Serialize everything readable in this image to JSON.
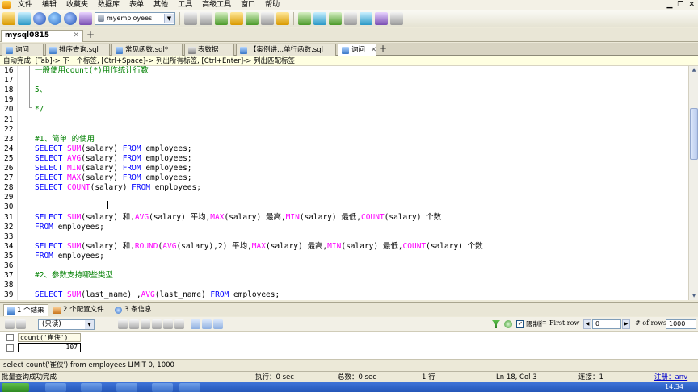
{
  "menu": [
    "文件",
    "编辑",
    "收藏夹",
    "数据库",
    "表单",
    "其他",
    "工具",
    "高级工具",
    "窗口",
    "帮助"
  ],
  "toolbar": {
    "db_select": "myemployees"
  },
  "connection_tab": {
    "label": "mysql0815"
  },
  "query_tabs": [
    {
      "label": "询问",
      "icon": "query-icon"
    },
    {
      "label": "排序查询.sql",
      "icon": "query-icon"
    },
    {
      "label": "常见函数.sql*",
      "icon": "query-icon"
    },
    {
      "label": "表数据",
      "icon": "table-icon"
    },
    {
      "label": "【案例讲...单行函数.sql",
      "icon": "query-icon"
    },
    {
      "label": "询问",
      "icon": "query-icon"
    }
  ],
  "hint": "自动完成: [Tab]-> 下一个标签, [Ctrl+Space]-> 列出所有标签, [Ctrl+Enter]-> 列出匹配标签",
  "editor_lines": [
    {
      "n": "16",
      "segs": [
        [
          "cm",
          "一般使用count(*)用作统计行数"
        ]
      ]
    },
    {
      "n": "17",
      "segs": []
    },
    {
      "n": "18",
      "segs": [
        [
          "cm",
          "5、"
        ]
      ]
    },
    {
      "n": "19",
      "segs": []
    },
    {
      "n": "20",
      "segs": [
        [
          "cm",
          "*/"
        ]
      ]
    },
    {
      "n": "21",
      "segs": []
    },
    {
      "n": "22",
      "segs": []
    },
    {
      "n": "23",
      "segs": [
        [
          "cm",
          "#1、简单 的使用"
        ]
      ]
    },
    {
      "n": "24",
      "segs": [
        [
          "kw",
          "SELECT "
        ],
        [
          "fn",
          "SUM"
        ],
        [
          "tx",
          "(salary) "
        ],
        [
          "kw",
          "FROM"
        ],
        [
          "tx",
          " employees;"
        ]
      ]
    },
    {
      "n": "25",
      "segs": [
        [
          "kw",
          "SELECT "
        ],
        [
          "fn",
          "AVG"
        ],
        [
          "tx",
          "(salary) "
        ],
        [
          "kw",
          "FROM"
        ],
        [
          "tx",
          " employees;"
        ]
      ]
    },
    {
      "n": "26",
      "segs": [
        [
          "kw",
          "SELECT "
        ],
        [
          "fn",
          "MIN"
        ],
        [
          "tx",
          "(salary) "
        ],
        [
          "kw",
          "FROM"
        ],
        [
          "tx",
          " employees;"
        ]
      ]
    },
    {
      "n": "27",
      "segs": [
        [
          "kw",
          "SELECT "
        ],
        [
          "fn",
          "MAX"
        ],
        [
          "tx",
          "(salary) "
        ],
        [
          "kw",
          "FROM"
        ],
        [
          "tx",
          " employees;"
        ]
      ]
    },
    {
      "n": "28",
      "segs": [
        [
          "kw",
          "SELECT "
        ],
        [
          "fn",
          "COUNT"
        ],
        [
          "tx",
          "(salary) "
        ],
        [
          "kw",
          "FROM"
        ],
        [
          "tx",
          " employees;"
        ]
      ]
    },
    {
      "n": "29",
      "segs": []
    },
    {
      "n": "30",
      "segs": []
    },
    {
      "n": "31",
      "segs": [
        [
          "kw",
          "SELECT "
        ],
        [
          "fn",
          "SUM"
        ],
        [
          "tx",
          "(salary) 和,"
        ],
        [
          "fn",
          "AVG"
        ],
        [
          "tx",
          "(salary) 平均,"
        ],
        [
          "fn",
          "MAX"
        ],
        [
          "tx",
          "(salary) 最高,"
        ],
        [
          "fn",
          "MIN"
        ],
        [
          "tx",
          "(salary) 最低,"
        ],
        [
          "fn",
          "COUNT"
        ],
        [
          "tx",
          "(salary) 个数"
        ]
      ]
    },
    {
      "n": "32",
      "segs": [
        [
          "kw",
          "FROM"
        ],
        [
          "tx",
          " employees;"
        ]
      ]
    },
    {
      "n": "33",
      "segs": []
    },
    {
      "n": "34",
      "segs": [
        [
          "kw",
          "SELECT "
        ],
        [
          "fn",
          "SUM"
        ],
        [
          "tx",
          "(salary) 和,"
        ],
        [
          "fn",
          "ROUND"
        ],
        [
          "tx",
          "("
        ],
        [
          "fn",
          "AVG"
        ],
        [
          "tx",
          "(salary),2) 平均,"
        ],
        [
          "fn",
          "MAX"
        ],
        [
          "tx",
          "(salary) 最高,"
        ],
        [
          "fn",
          "MIN"
        ],
        [
          "tx",
          "(salary) 最低,"
        ],
        [
          "fn",
          "COUNT"
        ],
        [
          "tx",
          "(salary) 个数"
        ]
      ]
    },
    {
      "n": "35",
      "segs": [
        [
          "kw",
          "FROM"
        ],
        [
          "tx",
          " employees;"
        ]
      ]
    },
    {
      "n": "36",
      "segs": []
    },
    {
      "n": "37",
      "segs": [
        [
          "cm",
          "#2、参数支持哪些类型"
        ]
      ]
    },
    {
      "n": "38",
      "segs": []
    },
    {
      "n": "39",
      "segs": [
        [
          "kw",
          "SELECT "
        ],
        [
          "fn",
          "SUM"
        ],
        [
          "tx",
          "(last_name) ,"
        ],
        [
          "fn",
          "AVG"
        ],
        [
          "tx",
          "(last_name) "
        ],
        [
          "kw",
          "FROM"
        ],
        [
          "tx",
          " employees;"
        ]
      ]
    }
  ],
  "result_tabs": [
    {
      "label": "1 个结果"
    },
    {
      "label": "2 个配置文件"
    },
    {
      "label": "3 条信息"
    }
  ],
  "result_toolbar": {
    "readonly": "(只读)",
    "limit_label": "限制行",
    "first_row_label": "First row",
    "first_row_value": "0",
    "rows_label": "# of rows",
    "rows_value": "1000"
  },
  "result_grid": {
    "header": "count('崔侠')",
    "value": "107"
  },
  "sql_status": "select count('崔侠') from employees LIMIT 0, 1000",
  "status_bar": {
    "message": "批量查询成功完成",
    "exec": "执行：0 sec",
    "total": "总数：0 sec",
    "rows": "1 行",
    "position": "Ln 18, Col 3",
    "connections": "连接：1",
    "user": "注册：anv"
  },
  "taskbar": {
    "clock": "14:34"
  },
  "colors": {
    "keyword": "#0000ff",
    "function": "#ff00ff",
    "comment": "#008000",
    "hint_bg": "#ffffe1"
  }
}
